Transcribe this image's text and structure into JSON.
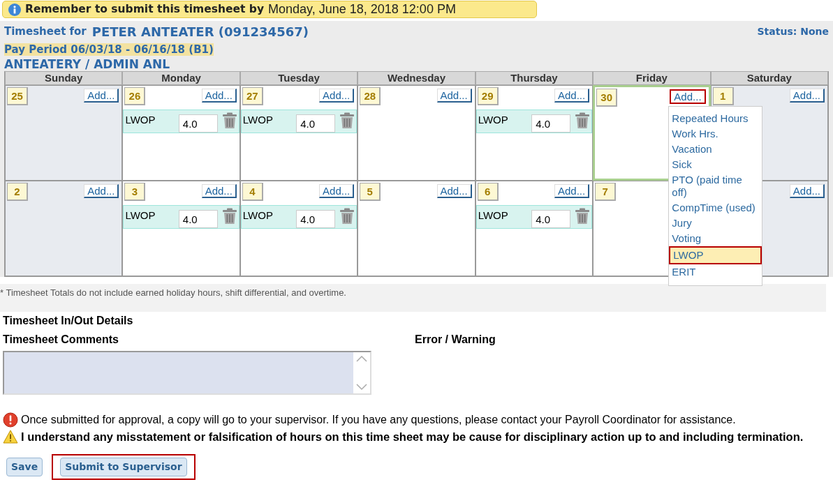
{
  "banner": {
    "label": "Remember to submit this timesheet by",
    "deadline": "Monday, June 18, 2018  12:00 PM"
  },
  "header": {
    "timesheet_label": "Timesheet for",
    "employee": "PETER ANTEATER (091234567)",
    "status": "Status: None",
    "pay_period": "Pay Period 06/03/18 - 06/16/18 (B1)",
    "department": "ANTEATERY / ADMIN ANL"
  },
  "calendar": {
    "days": [
      "Sunday",
      "Monday",
      "Tuesday",
      "Wednesday",
      "Thursday",
      "Friday",
      "Saturday"
    ],
    "weeks": [
      [
        {
          "date": "25",
          "weekend": true,
          "selected": false,
          "add": "Add...",
          "add_highlighted": false
        },
        {
          "date": "26",
          "weekend": false,
          "selected": false,
          "add": "Add...",
          "add_highlighted": false,
          "entries": [
            {
              "code": "LWOP",
              "hours": "4.0"
            }
          ]
        },
        {
          "date": "27",
          "weekend": false,
          "selected": false,
          "add": "Add...",
          "add_highlighted": false,
          "entries": [
            {
              "code": "LWOP",
              "hours": "4.0"
            }
          ]
        },
        {
          "date": "28",
          "weekend": false,
          "selected": false,
          "add": "Add...",
          "add_highlighted": false
        },
        {
          "date": "29",
          "weekend": false,
          "selected": false,
          "add": "Add...",
          "add_highlighted": false,
          "entries": [
            {
              "code": "LWOP",
              "hours": "4.0"
            }
          ]
        },
        {
          "date": "30",
          "weekend": false,
          "selected": true,
          "add": "Add...",
          "add_highlighted": true,
          "menu": [
            {
              "label": "Repeated Hours",
              "selected": false
            },
            {
              "label": "Work Hrs.",
              "selected": false
            },
            {
              "label": "Vacation",
              "selected": false
            },
            {
              "label": "Sick",
              "selected": false
            },
            {
              "label": "PTO (paid time off)",
              "selected": false
            },
            {
              "label": "CompTime (used)",
              "selected": false
            },
            {
              "label": "Jury",
              "selected": false
            },
            {
              "label": "Voting",
              "selected": false
            },
            {
              "label": "LWOP",
              "selected": true
            },
            {
              "label": "ERIT",
              "selected": false
            }
          ]
        },
        {
          "date": "1",
          "weekend": true,
          "selected": false,
          "add": "Add...",
          "add_highlighted": false
        }
      ],
      [
        {
          "date": "2",
          "weekend": true,
          "selected": false,
          "add": "Add...",
          "add_highlighted": false
        },
        {
          "date": "3",
          "weekend": false,
          "selected": false,
          "add": "Add...",
          "add_highlighted": false,
          "entries": [
            {
              "code": "LWOP",
              "hours": "4.0"
            }
          ]
        },
        {
          "date": "4",
          "weekend": false,
          "selected": false,
          "add": "Add...",
          "add_highlighted": false,
          "entries": [
            {
              "code": "LWOP",
              "hours": "4.0"
            }
          ]
        },
        {
          "date": "5",
          "weekend": false,
          "selected": false,
          "add": "Add...",
          "add_highlighted": false
        },
        {
          "date": "6",
          "weekend": false,
          "selected": false,
          "add": "Add...",
          "add_highlighted": false,
          "entries": [
            {
              "code": "LWOP",
              "hours": "4.0"
            }
          ]
        },
        {
          "date": "7",
          "weekend": false,
          "selected": false
        },
        {
          "weekend": true,
          "selected": false,
          "add": "Add...",
          "add_highlighted": false
        }
      ]
    ]
  },
  "footnote": "* Timesheet Totals do not include earned holiday hours, shift differential, and overtime.",
  "inout_title": "Timesheet In/Out Details",
  "comments_label": "Timesheet Comments",
  "error_label": "Error / Warning",
  "messages": [
    {
      "kind": "error",
      "text": "Once submitted for approval, a copy will go to your supervisor. If you have any questions, please contact your Payroll Coordinator for assistance."
    },
    {
      "kind": "warning",
      "text": "I understand any misstatement or falsification of hours on this time sheet may be cause for disciplinary action up to and including termination."
    }
  ],
  "buttons": [
    {
      "label": "Save",
      "highlighted": false
    },
    {
      "label": "Submit to Supervisor",
      "highlighted": true
    }
  ]
}
